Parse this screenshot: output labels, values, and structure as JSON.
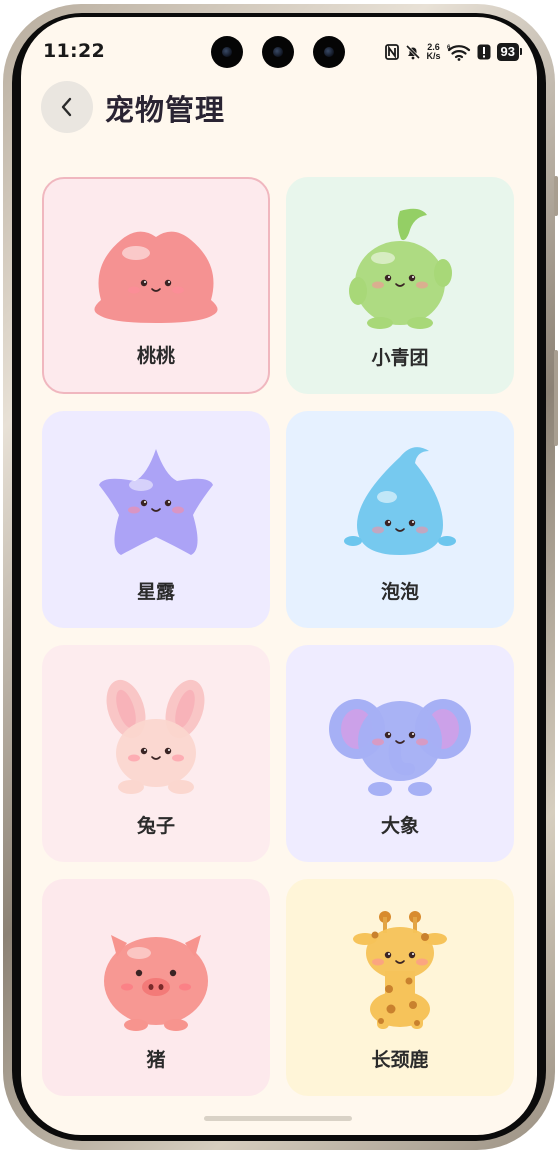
{
  "status_bar": {
    "time": "11:22",
    "net_speed_top": "2.6",
    "net_speed_bottom": "K/s",
    "battery": "93",
    "icons": [
      "nfc-icon",
      "mute-bell-icon",
      "network-speed-icon",
      "wifi-6-icon",
      "alert-icon",
      "battery-icon"
    ]
  },
  "header": {
    "back_icon": "chevron-left-icon",
    "title": "宠物管理"
  },
  "pets": [
    {
      "name": "桃桃",
      "selected": true,
      "bg": "#fdeaed",
      "color": "#f48a8a",
      "shape": "blob"
    },
    {
      "name": "小青团",
      "selected": false,
      "bg": "#e8f6ec",
      "color": "#a8d878",
      "shape": "sprout"
    },
    {
      "name": "星露",
      "selected": false,
      "bg": "#eeebff",
      "color": "#a69cf5",
      "shape": "star"
    },
    {
      "name": "泡泡",
      "selected": false,
      "bg": "#e6f1ff",
      "color": "#6cc6ee",
      "shape": "drop"
    },
    {
      "name": "兔子",
      "selected": false,
      "bg": "#fdecee",
      "color": "#f9c6c6",
      "shape": "bunny"
    },
    {
      "name": "大象",
      "selected": false,
      "bg": "#efecff",
      "color": "#a6b0f5",
      "shape": "elephant"
    },
    {
      "name": "猪",
      "selected": false,
      "bg": "#fde9ec",
      "color": "#f7948e",
      "shape": "pig"
    },
    {
      "name": "长颈鹿",
      "selected": false,
      "bg": "#fff5d8",
      "color": "#f6c35a",
      "shape": "giraffe"
    }
  ]
}
